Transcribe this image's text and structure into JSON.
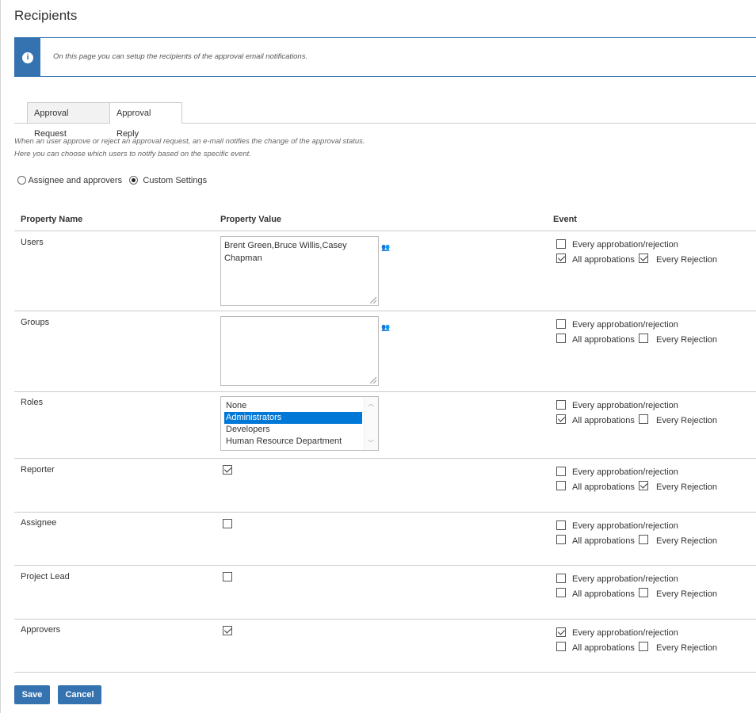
{
  "page": {
    "title": "Recipients"
  },
  "info": {
    "text": "On this page you can setup the recipients of the approval email notifications."
  },
  "tabs": [
    {
      "label": "Approval Request"
    },
    {
      "label": "Approval Reply"
    }
  ],
  "description": {
    "line1": "When an user approve or reject an approval request, an e-mail notifies the change of the approval status.",
    "line2": "Here you can choose which users to notify based on the specific event."
  },
  "mode": {
    "option1": "Assignee and approvers",
    "option2": "Custom Settings",
    "selected": "Custom Settings"
  },
  "table": {
    "headers": {
      "name": "Property Name",
      "value": "Property Value",
      "event": "Event"
    },
    "event_labels": {
      "every": "Every approbation/rejection",
      "all": "All approbations",
      "rejection": "Every Rejection"
    },
    "rows": {
      "users": {
        "name": "Users",
        "value_line1": "Brent Green,Bruce Willis,Casey",
        "value_line2": "Chapman",
        "every": false,
        "all": true,
        "rejection": true
      },
      "groups": {
        "name": "Groups",
        "every": false,
        "all": false,
        "rejection": false
      },
      "roles": {
        "name": "Roles",
        "options": [
          "None",
          "Administrators",
          "Developers",
          "Human Resource Department"
        ],
        "selected": "Administrators",
        "every": false,
        "all": true,
        "rejection": false
      },
      "reporter": {
        "name": "Reporter",
        "checked": true,
        "every": false,
        "all": false,
        "rejection": true
      },
      "assignee": {
        "name": "Assignee",
        "checked": false,
        "every": false,
        "all": false,
        "rejection": false
      },
      "project_lead": {
        "name": "Project Lead",
        "checked": false,
        "every": false,
        "all": false,
        "rejection": false
      },
      "approvers": {
        "name": "Approvers",
        "checked": true,
        "every": true,
        "all": false,
        "rejection": false
      }
    }
  },
  "actions": {
    "save": "Save",
    "cancel": "Cancel"
  },
  "colors": {
    "primary": "#3572b0",
    "selection": "#0078d7"
  }
}
